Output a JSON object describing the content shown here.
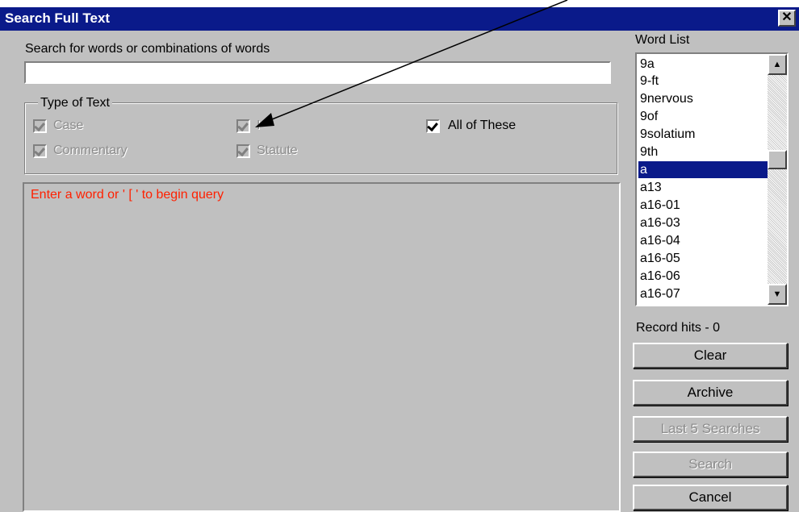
{
  "window": {
    "title": "Search Full Text",
    "close_glyph": "✕"
  },
  "search": {
    "label": "Search for words or combinations of words",
    "value": "",
    "placeholder": ""
  },
  "type_of_text": {
    "legend": "Type of Text",
    "options": [
      {
        "label": "Case",
        "checked": true,
        "enabled": false
      },
      {
        "label": "I",
        "checked": true,
        "enabled": false
      },
      {
        "label": "All of These",
        "checked": true,
        "enabled": true
      },
      {
        "label": "Commentary",
        "checked": true,
        "enabled": false
      },
      {
        "label": "Statute",
        "checked": true,
        "enabled": false
      }
    ]
  },
  "query": {
    "hint": "Enter a word or ' [ ' to begin query",
    "hint_color": "#ff2000"
  },
  "word_list": {
    "label": "Word List",
    "items": [
      "9a",
      "9-ft",
      "9nervous",
      "9of",
      "9solatium",
      "9th",
      "a",
      "a13",
      "a16-01",
      "a16-03",
      "a16-04",
      "a16-05",
      "a16-06",
      "a16-07"
    ],
    "selected_index": 6
  },
  "record_hits": "Record hits - 0",
  "buttons": {
    "clear": "Clear",
    "archive": "Archive",
    "last5": "Last 5 Searches",
    "search": "Search",
    "cancel": "Cancel"
  },
  "colors": {
    "title_bar": "#0a1a8a",
    "dialog_face": "#c0c0c0",
    "selection": "#0a1a8a"
  }
}
